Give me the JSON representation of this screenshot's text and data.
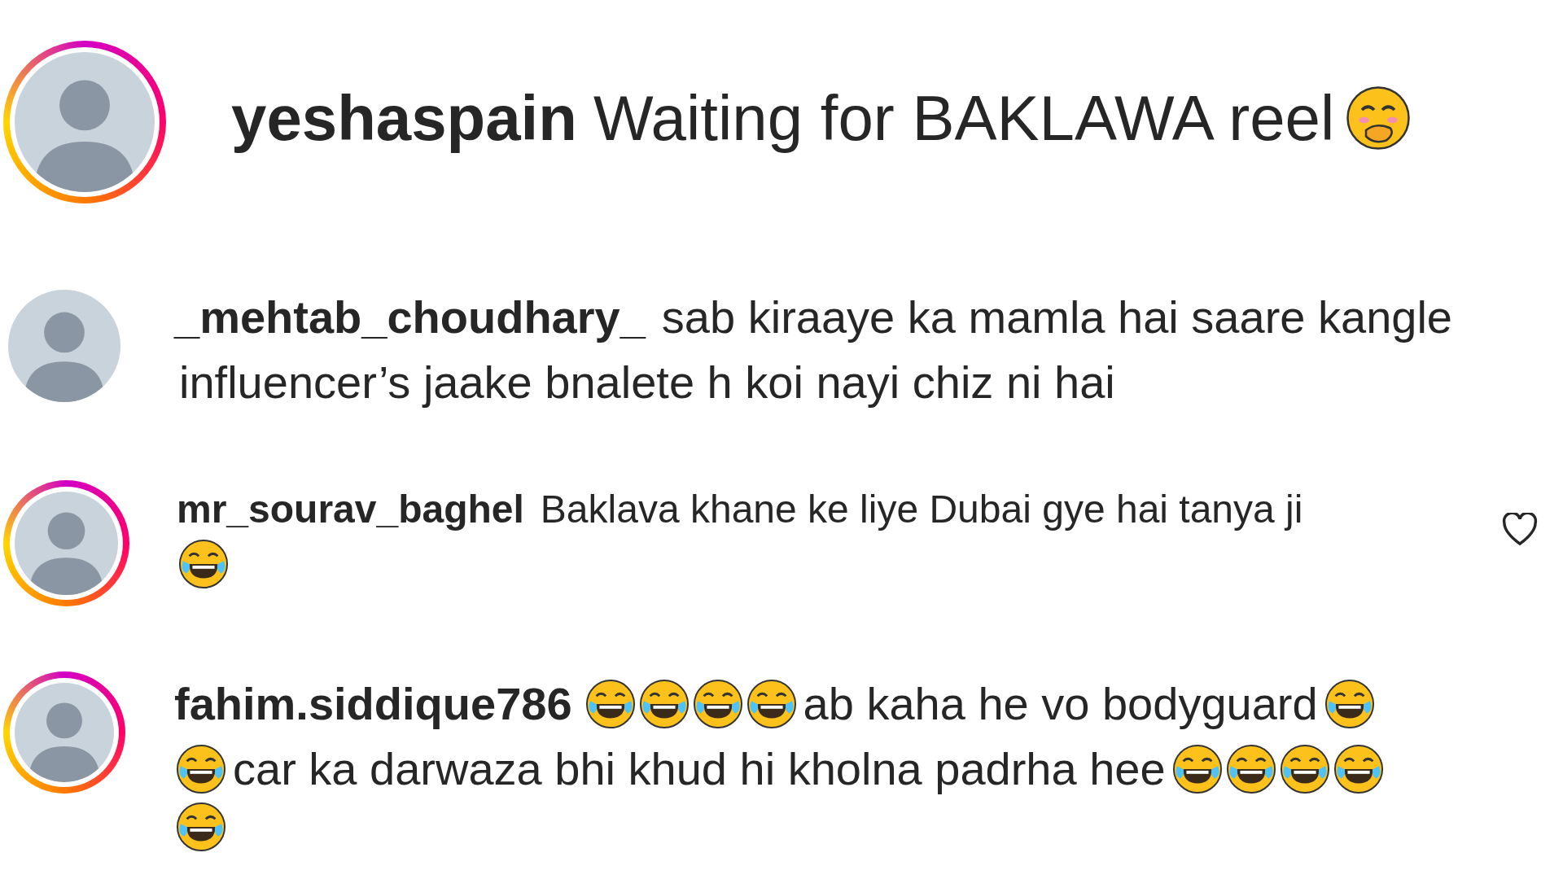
{
  "comments": [
    {
      "username": "yeshaspain",
      "story_ring": true,
      "heart": false,
      "lines": [
        [
          {
            "kind": "text",
            "text": "Waiting for BAKLAWA reel"
          },
          {
            "kind": "smile"
          }
        ]
      ]
    },
    {
      "username": "_mehtab_choudhary_",
      "story_ring": false,
      "heart": false,
      "lines": [
        [
          {
            "kind": "text",
            "text": "sab kiraaye ka mamla hai saare kangle"
          }
        ],
        [
          {
            "kind": "text",
            "text": "influencer’s jaake bnalete h koi nayi chiz ni hai"
          }
        ]
      ]
    },
    {
      "username": "mr_sourav_baghel",
      "story_ring": true,
      "heart": true,
      "lines": [
        [
          {
            "kind": "text",
            "text": "Baklava khane ke liye Dubai gye hai tanya ji"
          }
        ],
        [
          {
            "kind": "laugh"
          }
        ]
      ]
    },
    {
      "username": "fahim.siddique786",
      "story_ring": true,
      "heart": false,
      "lines": [
        [
          {
            "kind": "laugh"
          },
          {
            "kind": "laugh"
          },
          {
            "kind": "laugh"
          },
          {
            "kind": "laugh"
          },
          {
            "kind": "text",
            "text": "ab kaha he vo bodyguard"
          },
          {
            "kind": "laugh"
          }
        ],
        [
          {
            "kind": "laugh"
          },
          {
            "kind": "text",
            "text": "car ka darwaza bhi khud hi kholna padrha hee"
          },
          {
            "kind": "laugh"
          },
          {
            "kind": "laugh"
          },
          {
            "kind": "laugh"
          },
          {
            "kind": "laugh"
          }
        ],
        [
          {
            "kind": "laugh"
          }
        ]
      ]
    }
  ]
}
